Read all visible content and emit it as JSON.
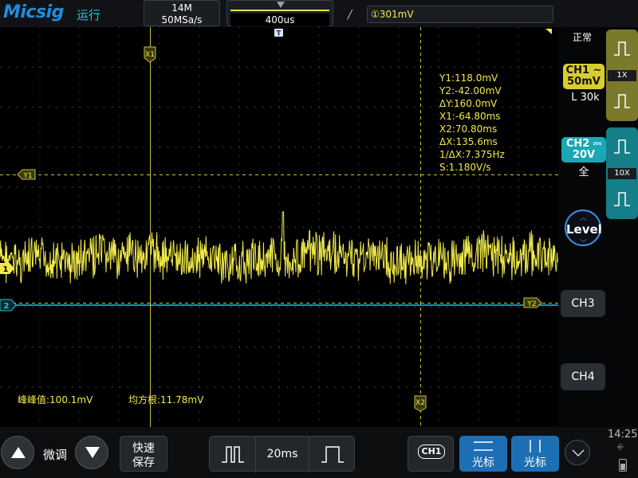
{
  "top_bar": {
    "brand": "Micsig",
    "run_status": "运行",
    "memory_depth": "14M",
    "sample_rate": "50MSa/s",
    "timebase_position": "400us",
    "trigger_edge_icon": "rising-edge-icon",
    "trigger_level": "①301mV"
  },
  "cursor_measurements": [
    "Y1:118.0mV",
    "Y2:-42.00mV",
    "ΔY:160.0mV",
    "X1:-64.80ms",
    "X2:70.80ms",
    "ΔX:135.6ms",
    "1/ΔX:7.375Hz",
    "S:1.180V/s"
  ],
  "auto_measurements": {
    "peak_to_peak": "峰峰值:100.1mV",
    "rms": "均方根:11.78mV"
  },
  "screen_markers": {
    "x1": "X1",
    "x2": "X2",
    "y1": "Y1",
    "y2": "Y2",
    "ch1": "1",
    "ch2": "2",
    "trigger_pos": "T"
  },
  "right_panel": {
    "status": "正常",
    "ch1": {
      "label": "CH1 ~",
      "scale": "50mV",
      "impedance": "L 30k",
      "probe": "1X"
    },
    "ch2": {
      "label": "CH2 ⎓",
      "scale": "20V",
      "coupling": "全",
      "probe": "10X"
    },
    "level": "Level",
    "ch3": "CH3",
    "ch4": "CH4"
  },
  "bottom_bar": {
    "fine_adjust": "微调",
    "quick_save_line1": "快速",
    "quick_save_line2": "保存",
    "timebase": "20ms",
    "source_chip": "CH1",
    "cursor_h": "光标",
    "cursor_v": "光标",
    "clock": "14:25"
  },
  "colors": {
    "ch1": "#f0e94a",
    "ch2": "#1ec8d8",
    "accent": "#1d6fb4"
  }
}
